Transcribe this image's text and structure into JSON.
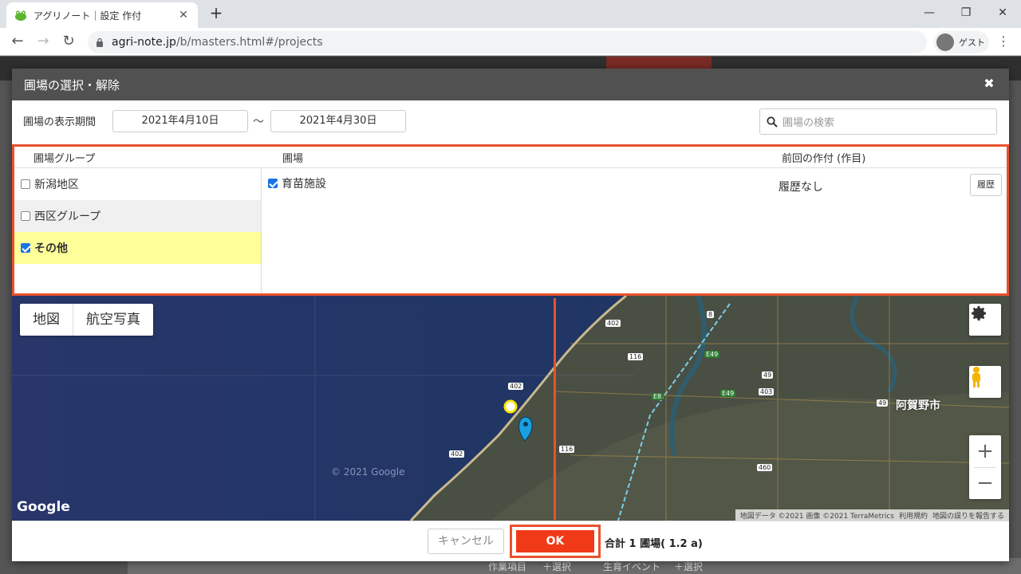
{
  "browser": {
    "tab_title": "アグリノート｜設定 作付",
    "url_host": "agri-note.jp",
    "url_path": "/b/masters.html#/projects",
    "profile_label": "ゲスト"
  },
  "background_app": {
    "bottom_items": [
      "作業項目",
      "＋選択",
      "生育イベント",
      "＋選択"
    ]
  },
  "modal": {
    "title": "圃場の選択・解除",
    "period_label": "圃場の表示期間",
    "date_from": "2021年4月10日",
    "tilde": "〜",
    "date_to": "2021年4月30日",
    "search_placeholder": "圃場の検索",
    "columns": {
      "group": "圃場グループ",
      "field": "圃場",
      "previous_crop": "前回の作付 (作目)"
    },
    "groups": [
      {
        "label": "新潟地区",
        "checked": false
      },
      {
        "label": "西区グループ",
        "checked": false
      },
      {
        "label": "その他",
        "checked": true
      }
    ],
    "fields": [
      {
        "label": "育苗施設",
        "checked": true,
        "previous": "履歴なし",
        "history_button": "履歴"
      }
    ],
    "map": {
      "type_map": "地図",
      "type_satellite": "航空写真",
      "city_label": "阿賀野市",
      "logo": "Google",
      "watermark": "© 2021 Google",
      "route_labels": [
        "402",
        "116",
        "8",
        "E49",
        "49",
        "403",
        "E8",
        "460"
      ],
      "attribution": [
        "地図データ ©2021 画像 ©2021 TerraMetrics",
        "利用規約",
        "地図の誤りを報告する"
      ],
      "zoom_in": "+",
      "zoom_out": "−"
    },
    "footer": {
      "cancel": "キャンセル",
      "ok": "OK",
      "total": "合計 1 圃場( 1.2 a)"
    }
  },
  "colors": {
    "header_bg": "#515151",
    "highlight": "#e8522e",
    "ok_bg": "#f03a17",
    "selected_row": "#ffff99"
  }
}
